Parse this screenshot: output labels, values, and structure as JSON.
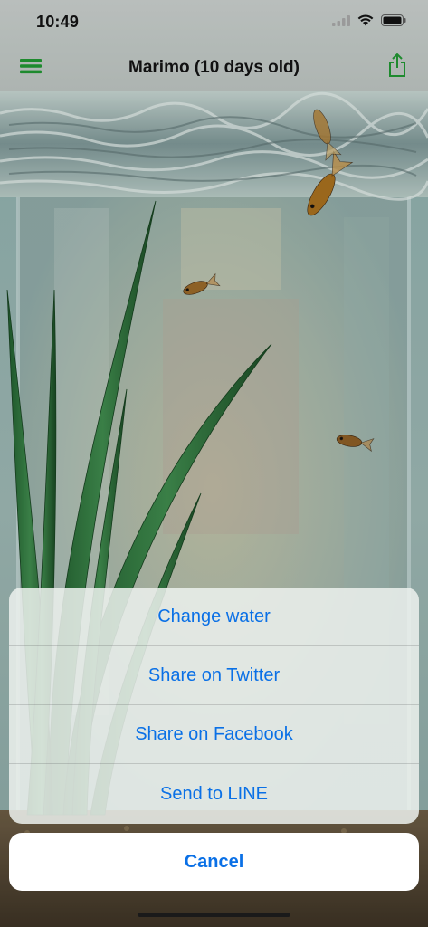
{
  "status_bar": {
    "time": "10:49",
    "icons": [
      "signal-icon",
      "wifi-icon",
      "battery-icon"
    ]
  },
  "nav_bar": {
    "title": "Marimo (10 days old)",
    "left_icon": "menu-icon",
    "right_icon": "share-icon",
    "accent_color": "#1e8a2e"
  },
  "action_sheet": {
    "items": [
      {
        "label": "Change water"
      },
      {
        "label": "Share on Twitter"
      },
      {
        "label": "Share on Facebook"
      },
      {
        "label": "Send to LINE"
      }
    ],
    "cancel_label": "Cancel",
    "text_color": "#0a70e6"
  },
  "scene": {
    "description_icons": [
      "aquarium-background",
      "goldfish",
      "water-plant"
    ]
  }
}
